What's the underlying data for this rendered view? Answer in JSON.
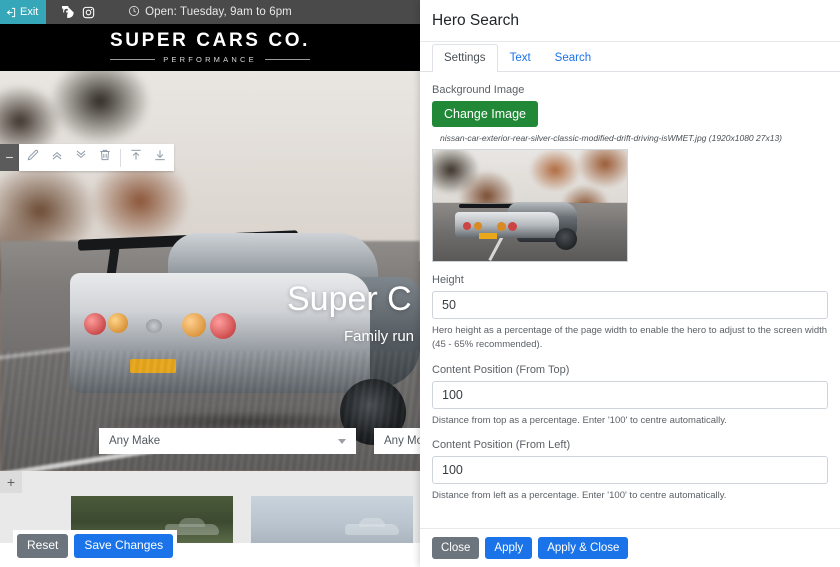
{
  "site": {
    "topbar": {
      "exit_label": "Exit",
      "exit_icon": "exit-arrow-icon",
      "facebook_icon": "facebook-icon",
      "instagram_icon": "instagram-icon",
      "clock_icon": "clock-icon",
      "hours_text": "Open: Tuesday, 9am to 6pm"
    },
    "logo": {
      "name": "SUPER CARS CO.",
      "tagline": "PERFORMANCE"
    },
    "hero": {
      "title": "Super C",
      "subtitle": "Family run",
      "search": {
        "make_value": "Any Make",
        "model_value": "Any Mod"
      }
    },
    "toolbar": {
      "collapse_icon": "minus-icon",
      "edit_icon": "pencil-icon",
      "move_up_icon": "chevron-double-up-icon",
      "move_down_icon": "chevron-double-down-icon",
      "delete_icon": "trash-icon",
      "move_to_top_icon": "upload-arrow-icon",
      "move_to_bottom_icon": "download-arrow-icon"
    },
    "add_block_label": "+"
  },
  "panel": {
    "title": "Hero Search",
    "tabs": [
      {
        "label": "Settings",
        "active": true
      },
      {
        "label": "Text",
        "active": false
      },
      {
        "label": "Search",
        "active": false
      }
    ],
    "background_image": {
      "label": "Background Image",
      "change_button": "Change Image",
      "file_meta": "nissan-car-exterior-rear-silver-classic-modified-drift-driving-isWMET.jpg (1920x1080 27x13)",
      "preview_alt": "hero-background-preview"
    },
    "fields": [
      {
        "label": "Height",
        "value": "50",
        "help": "Hero height as a percentage of the page width to enable the hero to adjust to the screen width (45 - 65% recommended)."
      },
      {
        "label": "Content Position (From Top)",
        "value": "100",
        "help": "Distance from top as a percentage. Enter '100' to centre automatically."
      },
      {
        "label": "Content Position (From Left)",
        "value": "100",
        "help": "Distance from left as a percentage. Enter '100' to centre automatically."
      }
    ],
    "footer": {
      "close_label": "Close",
      "apply_label": "Apply",
      "apply_close_label": "Apply & Close"
    }
  },
  "editor_actions": {
    "reset_label": "Reset",
    "save_label": "Save Changes"
  },
  "colors": {
    "accent_teal": "#36a7b8",
    "primary_blue": "#1a73e8",
    "green": "#218838",
    "secondary_grey": "#6c757d",
    "link_blue": "#1a73e8"
  }
}
